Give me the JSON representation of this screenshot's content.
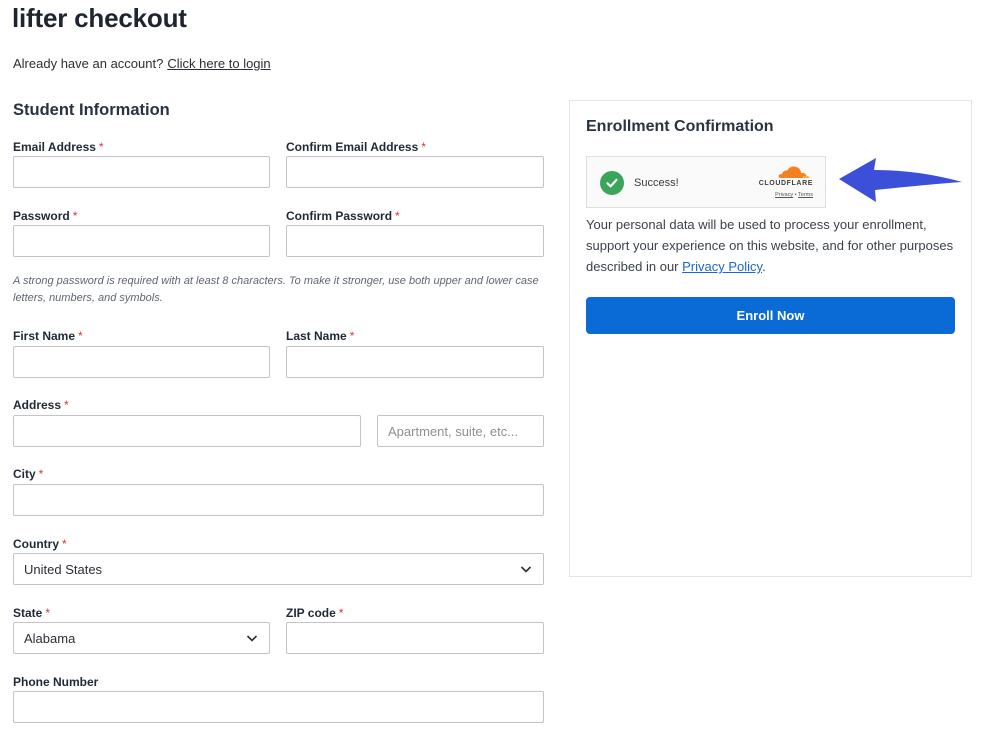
{
  "page": {
    "title": "lifter checkout",
    "account_prompt": "Already have an account?",
    "login_link": "Click here to login"
  },
  "student_info": {
    "heading": "Student Information",
    "required_mark": "*",
    "email": {
      "label": "Email Address",
      "value": ""
    },
    "confirm_email": {
      "label": "Confirm Email Address",
      "value": ""
    },
    "password": {
      "label": "Password",
      "value": ""
    },
    "confirm_password": {
      "label": "Confirm Password",
      "value": ""
    },
    "password_hint": "A strong password is required with at least 8 characters. To make it stronger, use both upper and lower case letters, numbers, and symbols.",
    "first_name": {
      "label": "First Name",
      "value": ""
    },
    "last_name": {
      "label": "Last Name",
      "value": ""
    },
    "address": {
      "label": "Address",
      "value": ""
    },
    "address2": {
      "placeholder": "Apartment, suite, etc...",
      "value": ""
    },
    "city": {
      "label": "City",
      "value": ""
    },
    "country": {
      "label": "Country",
      "selected": "United States"
    },
    "state": {
      "label": "State",
      "selected": "Alabama"
    },
    "zip": {
      "label": "ZIP code",
      "value": ""
    },
    "phone": {
      "label": "Phone Number",
      "value": ""
    }
  },
  "enrollment": {
    "heading": "Enrollment Confirmation",
    "captcha": {
      "status": "Success!",
      "provider": "CLOUDFLARE",
      "privacy_link": "Privacy",
      "separator": "•",
      "terms_link": "Terms",
      "status_color": "#3ba55c",
      "brand_color": "#f48120"
    },
    "privacy_text_before": "Your personal data will be used to process your enrollment, support your experience on this website, and for other purposes described in our",
    "privacy_link": "Privacy Policy",
    "privacy_text_after": ".",
    "enroll_button": "Enroll Now",
    "accent_color": "#0a6ad6"
  },
  "annotation": {
    "arrow_color": "#3b4fd8",
    "icon": "arrow-left-icon"
  }
}
